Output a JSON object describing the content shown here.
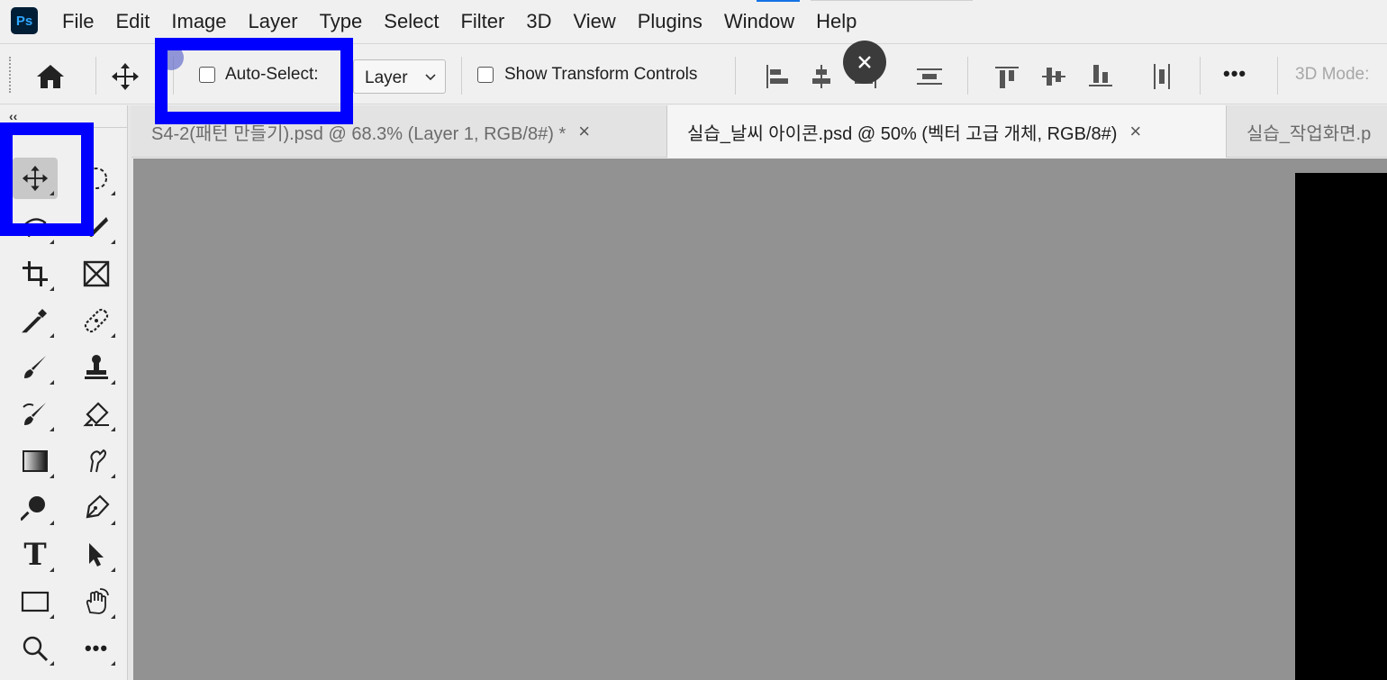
{
  "app": {
    "logo_text": "Ps"
  },
  "menu": [
    "File",
    "Edit",
    "Image",
    "Layer",
    "Type",
    "Select",
    "Filter",
    "3D",
    "View",
    "Plugins",
    "Window",
    "Help"
  ],
  "options_bar": {
    "auto_select_label": "Auto-Select:",
    "auto_select_checked": false,
    "target_value": "Layer",
    "show_transform_label": "Show Transform Controls",
    "show_transform_checked": false,
    "more_label": "•••",
    "mode_label": "3D Mode:"
  },
  "tabs": [
    {
      "title": "S4-2(패턴 만들기).psd @ 68.3% (Layer 1, RGB/8#) *",
      "close": "×",
      "active": false
    },
    {
      "title": "실습_날씨 아이콘.psd @ 50% (벡터 고급 개체, RGB/8#)",
      "close": "×",
      "active": true
    },
    {
      "title": "실습_작업화면.p",
      "close": "",
      "active": false
    }
  ],
  "tool_panel": {
    "collapse_label": "‹‹",
    "type_tool_glyph": "T",
    "more_tools_glyph": "•••"
  },
  "overlay": {
    "close_label": "×"
  },
  "colors": {
    "highlight": "#0000ff",
    "canvas_bg": "#929292",
    "ps_brand": "#31a8ff",
    "ps_logo_bg": "#001e36"
  }
}
